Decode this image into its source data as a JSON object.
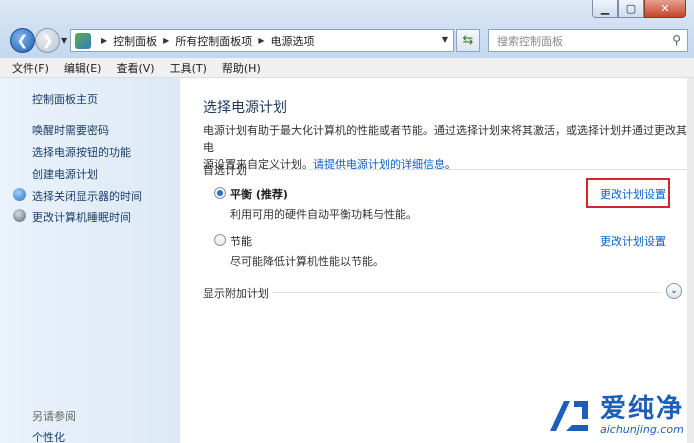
{
  "window": {
    "minimize_glyph": "▁",
    "maximize_glyph": "▢",
    "close_glyph": "✕"
  },
  "nav": {
    "back_glyph": "❮",
    "forward_glyph": "❯",
    "breadcrumbs": [
      "控制面板",
      "所有控制面板项",
      "电源选项"
    ],
    "search_placeholder": "搜索控制面板"
  },
  "menubar": [
    "文件(F)",
    "编辑(E)",
    "查看(V)",
    "工具(T)",
    "帮助(H)"
  ],
  "sidebar": {
    "home": "控制面板主页",
    "items": [
      "唤醒时需要密码",
      "选择电源按钮的功能",
      "创建电源计划",
      "选择关闭显示器的时间",
      "更改计算机睡眠时间"
    ],
    "see_also": "另请参阅",
    "personalize": "个性化"
  },
  "main": {
    "title": "选择电源计划",
    "description_line1": "电源计划有助于最大化计算机的性能或者节能。通过选择计划来将其激活，或选择计划并通过更改其电",
    "description_line2_prefix": "源设置来自定义计划。",
    "description_link": "请提供电源计划的详细信息",
    "description_suffix": "。",
    "preferred_label": "首选计划",
    "plans": [
      {
        "name": "平衡 (推荐)",
        "desc": "利用可用的硬件自动平衡功耗与性能。",
        "link": "更改计划设置",
        "selected": true
      },
      {
        "name": "节能",
        "desc": "尽可能降低计算机性能以节能。",
        "link": "更改计划设置",
        "selected": false
      }
    ],
    "additional_label": "显示附加计划",
    "expand_glyph": "⌄"
  },
  "watermark": {
    "cn": "爱纯净",
    "url": "aichunjing.com"
  },
  "colors": {
    "link": "#0a5fc9",
    "highlight": "#d4262a",
    "watermark": "#1c5fb8"
  }
}
